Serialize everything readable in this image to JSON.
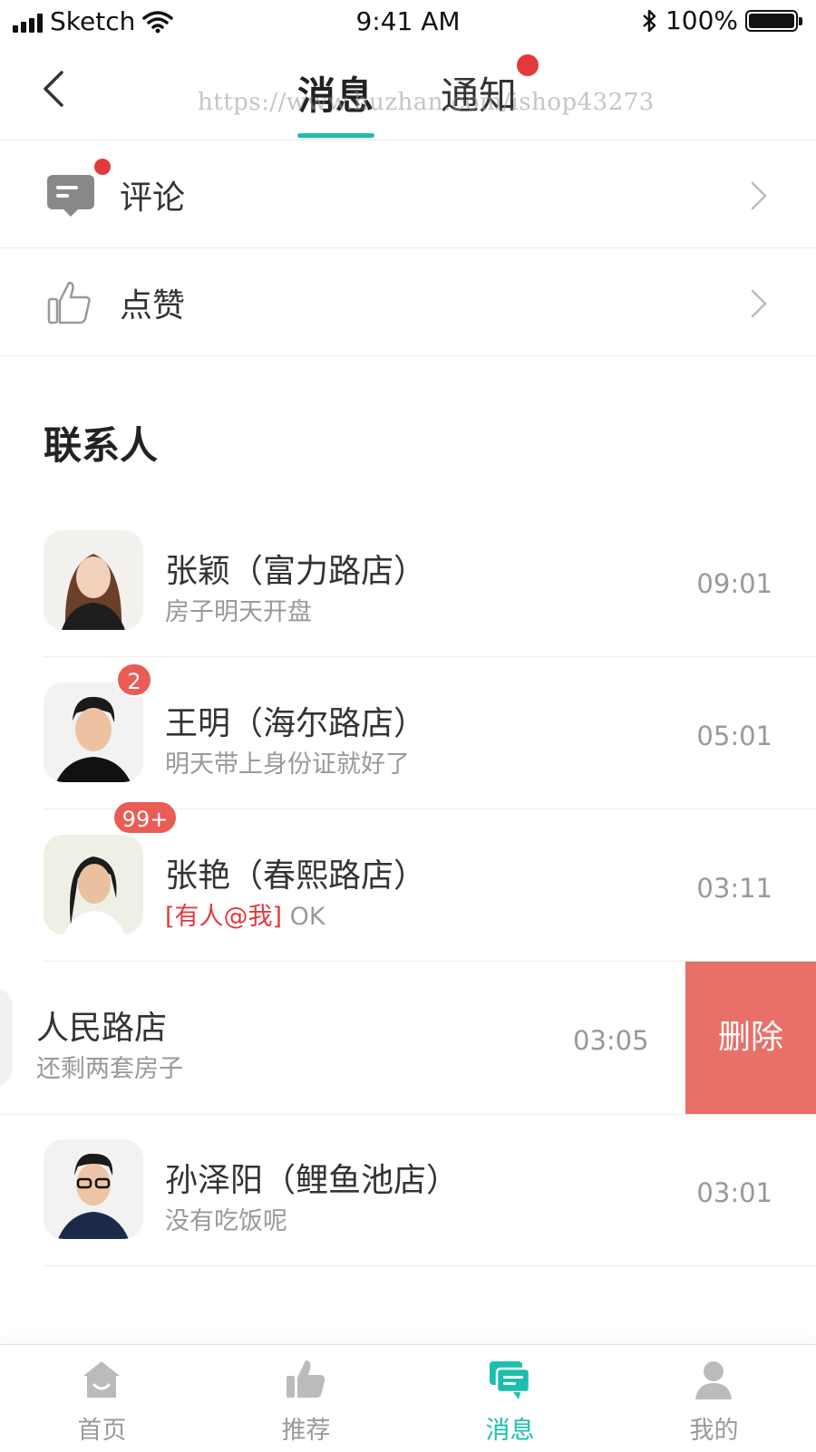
{
  "status_bar": {
    "carrier": "Sketch",
    "time": "9:41 AM",
    "battery": "100%"
  },
  "nav": {
    "tabs": [
      {
        "label": "消息",
        "active": true
      },
      {
        "label": "通知",
        "has_dot": true
      }
    ],
    "watermark": "https://www.huzhan.com/ishop43273"
  },
  "colors": {
    "accent": "#1bbfae",
    "red": "#e4393c",
    "badge": "#ea5c56",
    "delete": "#e87069"
  },
  "rows": [
    {
      "label": "评论",
      "icon": "comment-icon",
      "has_dot": true
    },
    {
      "label": "点赞",
      "icon": "thumbs-up-icon",
      "has_dot": false
    }
  ],
  "contacts_title": "联系人",
  "contacts": [
    {
      "name": "张颖（富力路店）",
      "message": "房子明天开盘",
      "time": "09:01"
    },
    {
      "name": "王明（海尔路店）",
      "message": "明天带上身份证就好了",
      "time": "05:01",
      "badge": "2"
    },
    {
      "name": "张艳（春熙路店）",
      "mention": "[有人@我]",
      "message": "OK",
      "time": "03:11",
      "badge": "99+"
    },
    {
      "name": "人民路店",
      "message": "还剩两套房子",
      "time": "03:05",
      "action": "删除"
    },
    {
      "name": "孙泽阳（鲤鱼池店）",
      "message": "没有吃饭呢",
      "time": "03:01"
    }
  ],
  "tabbar": [
    {
      "label": "首页",
      "icon": "home-icon"
    },
    {
      "label": "推荐",
      "icon": "thumbs-up-icon"
    },
    {
      "label": "消息",
      "icon": "chat-icon",
      "active": true
    },
    {
      "label": "我的",
      "icon": "user-icon"
    }
  ]
}
